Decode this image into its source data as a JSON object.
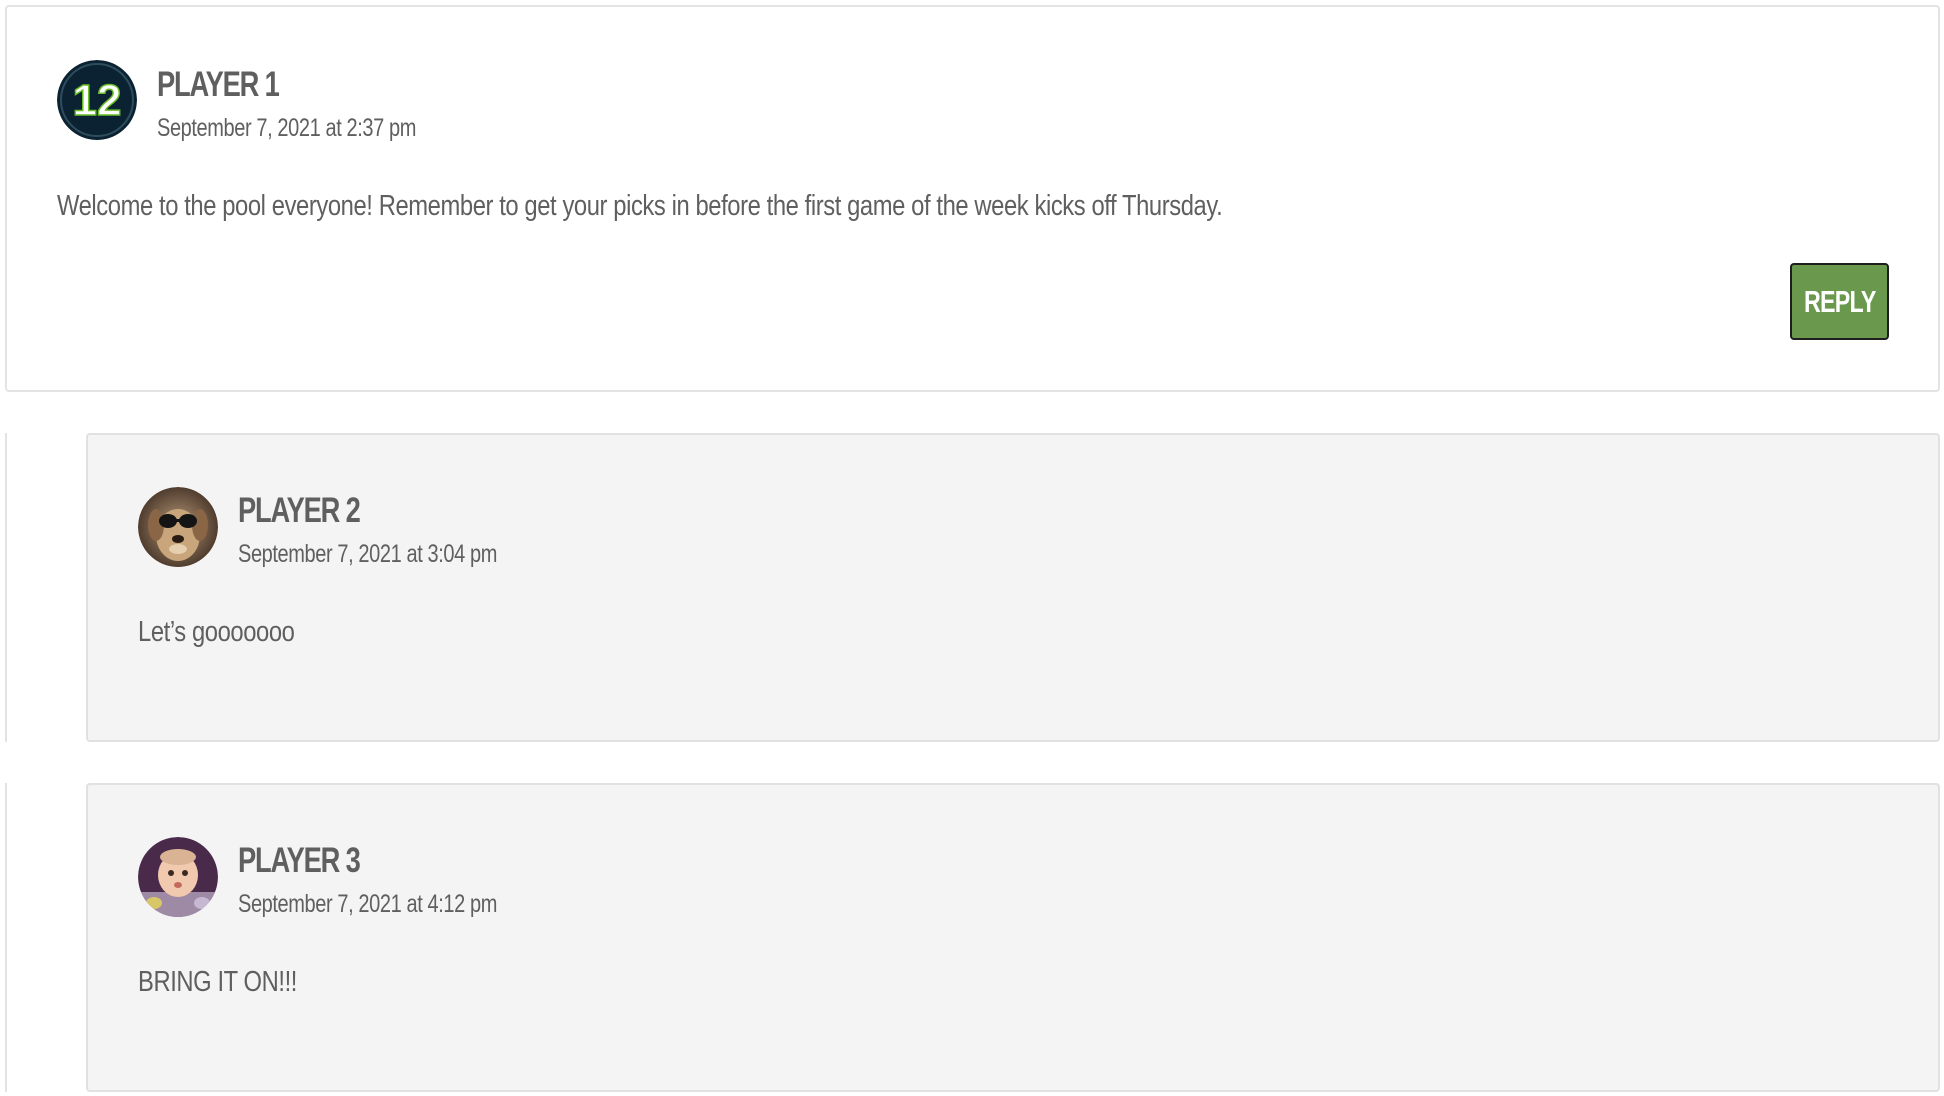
{
  "comments": [
    {
      "author": "PLAYER 1",
      "date": "September 7, 2021 at 2:37 pm",
      "text": "Welcome to the pool everyone! Remember to get your picks in before the first game of the week kicks off Thursday.",
      "avatar_icon": "jersey-number-12-avatar",
      "reply_label": "REPLY"
    },
    {
      "author": "PLAYER 2",
      "date": "September 7, 2021 at 3:04 pm",
      "text": "Let’s gooooooo",
      "avatar_icon": "dog-with-sunglasses-avatar"
    },
    {
      "author": "PLAYER 3",
      "date": "September 7, 2021 at 4:12 pm",
      "text": "BRING IT ON!!!",
      "avatar_icon": "baby-photo-avatar"
    }
  ],
  "colors": {
    "reply_button": "#6a994d",
    "reply_background": "#f4f4f4",
    "text": "#5f5f5f",
    "avatar_12_bg": "#0b2232",
    "avatar_12_accent": "#69be28"
  }
}
